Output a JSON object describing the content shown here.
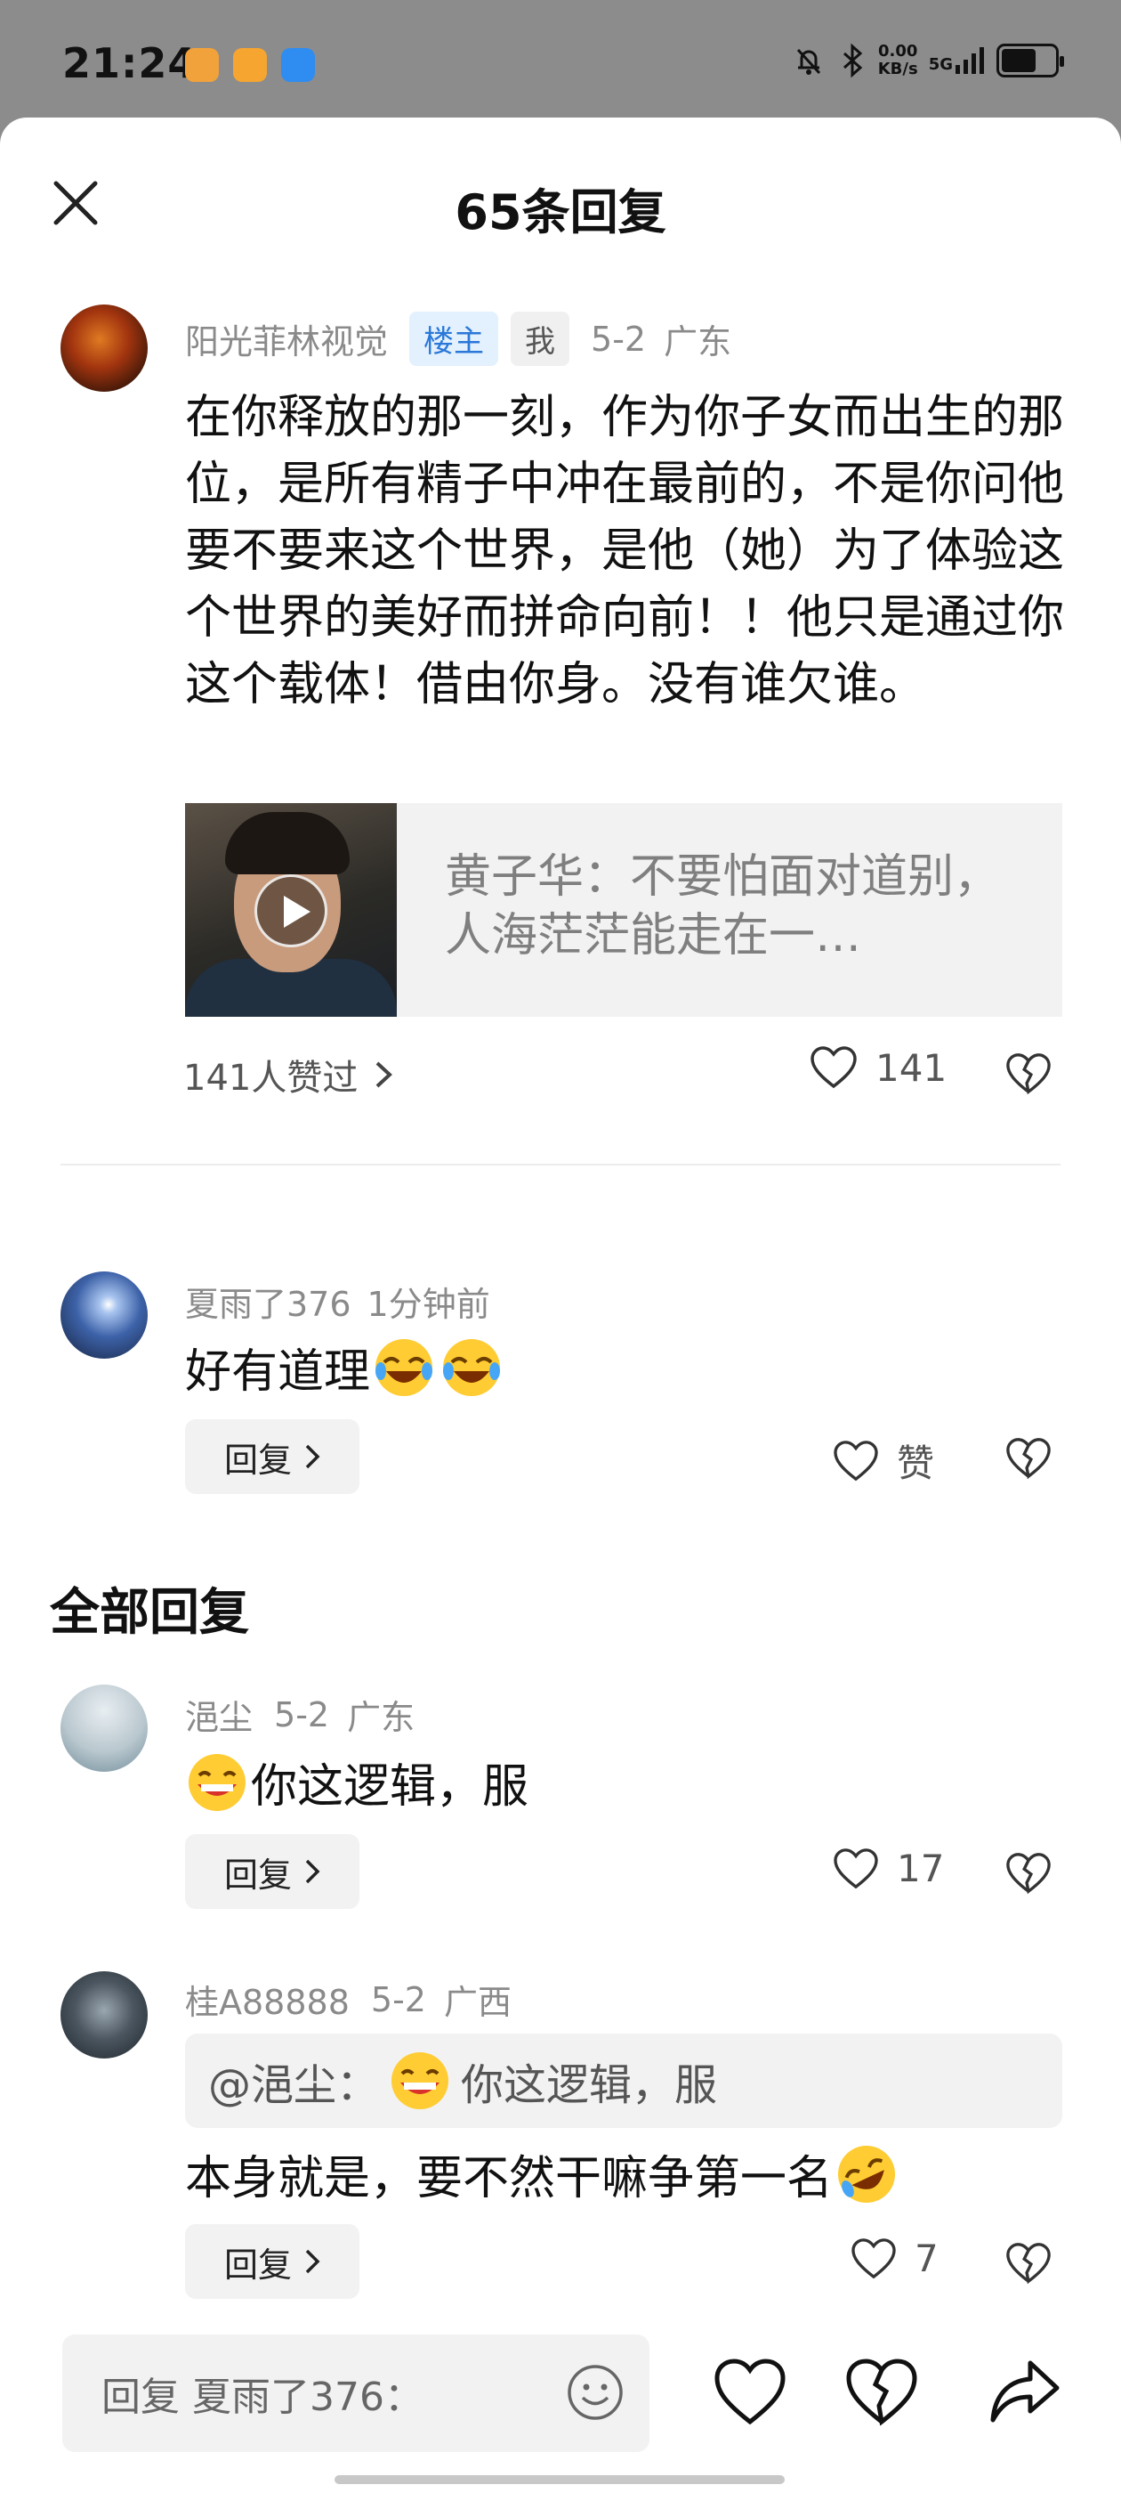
{
  "status_bar": {
    "time": "21:24",
    "net_speed_value": "0.00",
    "net_speed_unit": "KB/s",
    "signal": "5G"
  },
  "sheet": {
    "title": "65条回复"
  },
  "main_comment": {
    "author": "阳光菲林视觉",
    "badge_owner": "楼主",
    "badge_me": "我",
    "date": "5-2",
    "location": "广东",
    "text": "在你释放的那一刻，作为你子女而出生的那位，是所有精子中冲在最前的，不是你问他要不要来这个世界，是他（她）为了体验这个世界的美好而拼命向前！！他只是通过你这个载体！借由你身。没有谁欠谁。",
    "video_title": "黄子华：不要怕面对道别，人海茫茫能走在一…",
    "likes_summary": "141人赞过",
    "like_count": "141"
  },
  "replies": [
    {
      "author": "夏雨了376",
      "time": "1分钟前",
      "text": "好有道理",
      "reply_label": "回复",
      "like_label": "赞"
    }
  ],
  "all_replies": {
    "section_title": "全部回复",
    "items": [
      {
        "author": "浥尘",
        "date": "5-2",
        "location": "广东",
        "text": "你这逻辑，服",
        "reply_label": "回复",
        "like_count": "17"
      },
      {
        "author": "桂A88888",
        "date": "5-2",
        "location": "广西",
        "quote_author": "@浥尘：",
        "quote_text": "你这逻辑，服",
        "text": "本身就是，要不然干嘛争第一名",
        "reply_label": "回复",
        "like_count": "7"
      }
    ]
  },
  "bottom_bar": {
    "input_placeholder": "回复 夏雨了376："
  },
  "colors": {
    "owner_badge_bg": "#e3f0fd",
    "owner_badge_text": "#2a78d8",
    "status_bar_bg": "#8c8c8c"
  }
}
